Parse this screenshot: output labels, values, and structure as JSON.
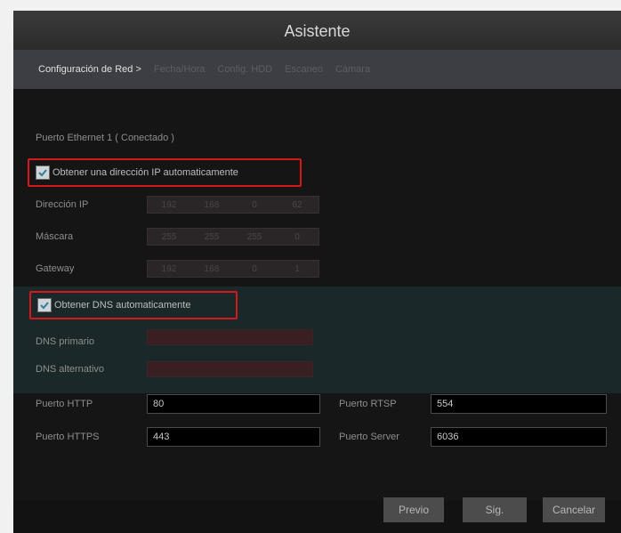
{
  "title": "Asistente",
  "steps": {
    "active": "Configuración de Red >",
    "inactive": [
      "Fecha/Hora",
      "Config. HDD",
      "Escaneo",
      "Cámara"
    ]
  },
  "ethernet": {
    "port_label": "Puerto Ethernet 1 ( Conectado )",
    "auto_ip_label": "Obtener una dirección IP automaticamente",
    "auto_ip_checked": true,
    "ip_label": "Dirección IP",
    "ip": [
      "192",
      "168",
      "0",
      "62"
    ],
    "mask_label": "Máscara",
    "mask": [
      "255",
      "255",
      "255",
      "0"
    ],
    "gateway_label": "Gateway",
    "gateway": [
      "192",
      "168",
      "0",
      "1"
    ]
  },
  "dns": {
    "auto_dns_label": "Obtener DNS automaticamente",
    "auto_dns_checked": true,
    "primary_label": "DNS primario",
    "secondary_label": "DNS alternativo"
  },
  "ports": {
    "http_label": "Puerto HTTP",
    "http_value": "80",
    "rtsp_label": "Puerto RTSP",
    "rtsp_value": "554",
    "https_label": "Puerto HTTPS",
    "https_value": "443",
    "server_label": "Puerto Server",
    "server_value": "6036"
  },
  "buttons": {
    "prev": "Previo",
    "next": "Sig.",
    "cancel": "Cancelar"
  },
  "colors": {
    "highlight_border": "#d6171c",
    "titlebar": "#2f2f2f",
    "window_bg": "#151515"
  }
}
